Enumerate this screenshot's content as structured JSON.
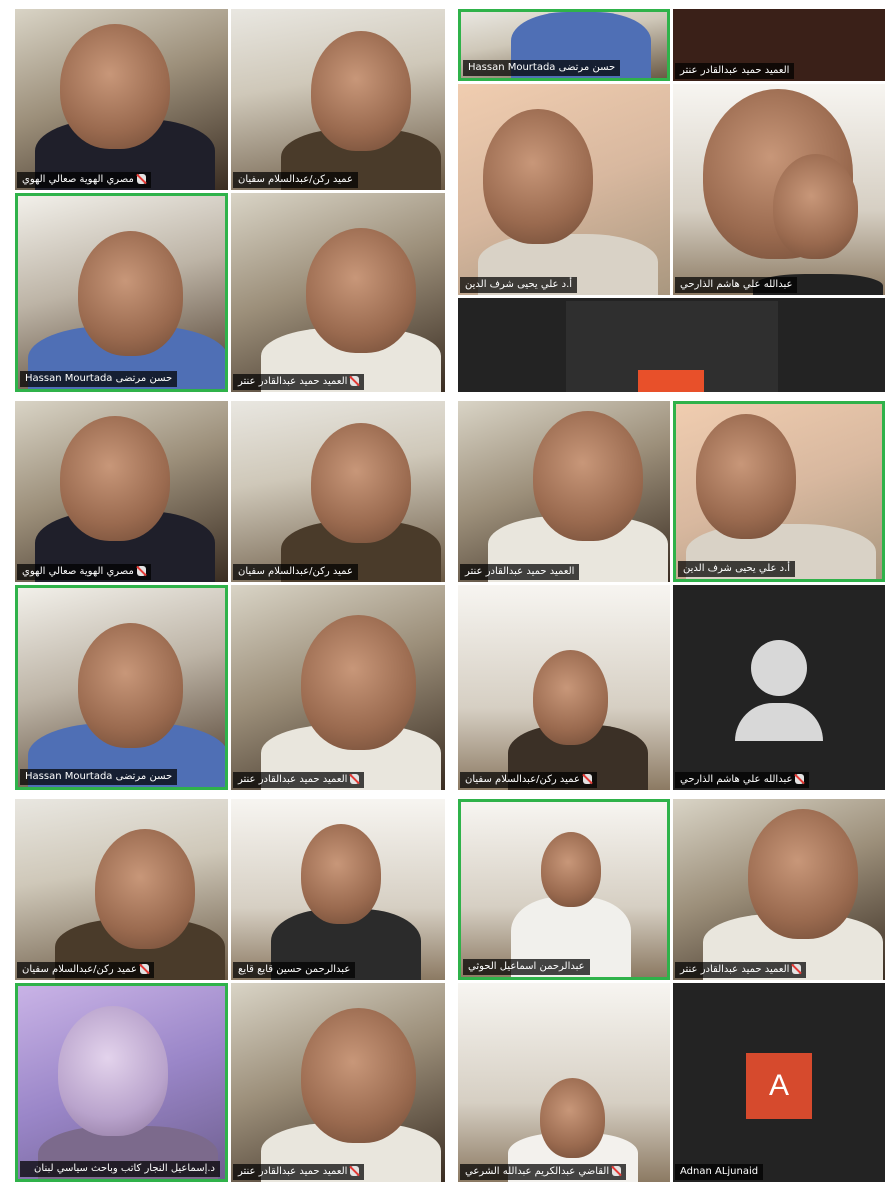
{
  "colors": {
    "active_border": "#2fb24a",
    "tile_dark": "#232323",
    "avatar_letter_bg": "#d64a2d"
  },
  "screens": [
    {
      "tiles": [
        {
          "label": "مصري الهوية صعالي الهوي"
        },
        {
          "label": "عميد ركن/عبدالسلام سفيان"
        },
        {
          "label": "Hassan Mourtada  حسن مرتضى"
        },
        {
          "label": "العميد حميد عبدالقادر عنتر"
        }
      ]
    },
    {
      "tiles": [
        {
          "label": "Hassan Mourtada  حسن مرتضى"
        },
        {
          "label": "العميد حميد عبدالقادر عنتر"
        },
        {
          "label": "أ.د علي يحيى شرف الدين"
        },
        {
          "label": "عبدالله علي هاشم الذارحي"
        }
      ]
    },
    {
      "tiles": [
        {
          "label": "مصري الهوية صعالي الهوي"
        },
        {
          "label": "عميد ركن/عبدالسلام سفيان"
        },
        {
          "label": "Hassan Mourtada  حسن مرتضى"
        },
        {
          "label": "العميد حميد عبدالقادر عنتر"
        }
      ]
    },
    {
      "tiles": [
        {
          "label": "العميد حميد عبدالقادر عنتر"
        },
        {
          "label": "أ.د علي يحيى شرف الدين"
        },
        {
          "label": "عميد ركن/عبدالسلام سفيان"
        },
        {
          "label": "عبدالله علي هاشم الذارحي"
        }
      ]
    },
    {
      "tiles": [
        {
          "label": "عميد ركن/عبدالسلام سفيان"
        },
        {
          "label": "عبدالرحمن حسين قايع قايع"
        },
        {
          "label": "د.إسماعيل النجار كاتب وباحث سياسي لبنان"
        },
        {
          "label": "العميد حميد عبدالقادر عنتر"
        }
      ]
    },
    {
      "tiles": [
        {
          "label": "عبدالرحمن اسماعيل الحوثي"
        },
        {
          "label": "العميد حميد عبدالقادر عنتر"
        },
        {
          "label": "القاضي عبدالكريم عبدالله الشرعي"
        },
        {
          "label": "Adnan ALjunaid",
          "avatar_letter": "A"
        }
      ]
    }
  ]
}
